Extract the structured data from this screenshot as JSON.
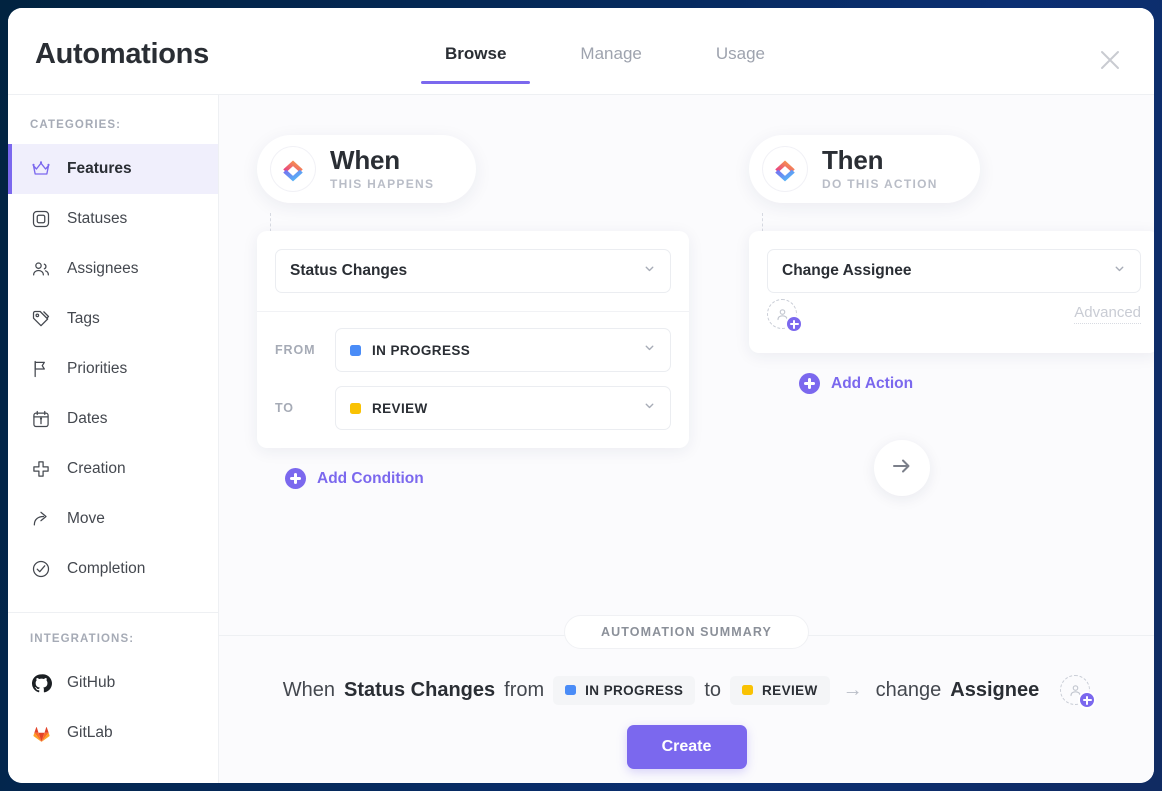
{
  "window": {
    "title": "Automations",
    "close_icon": "close-icon"
  },
  "tabs": [
    {
      "label": "Browse",
      "active": true
    },
    {
      "label": "Manage",
      "active": false
    },
    {
      "label": "Usage",
      "active": false
    }
  ],
  "sidebar": {
    "categories_heading": "CATEGORIES:",
    "integrations_heading": "INTEGRATIONS:",
    "categories": [
      {
        "label": "Features",
        "icon": "crown-icon",
        "active": true
      },
      {
        "label": "Statuses",
        "icon": "square-status-icon",
        "active": false
      },
      {
        "label": "Assignees",
        "icon": "users-icon",
        "active": false
      },
      {
        "label": "Tags",
        "icon": "tag-icon",
        "active": false
      },
      {
        "label": "Priorities",
        "icon": "flag-icon",
        "active": false
      },
      {
        "label": "Dates",
        "icon": "calendar-icon",
        "active": false
      },
      {
        "label": "Creation",
        "icon": "plus-icon",
        "active": false
      },
      {
        "label": "Move",
        "icon": "arrow-forward-icon",
        "active": false
      },
      {
        "label": "Completion",
        "icon": "check-circle-icon",
        "active": false
      }
    ],
    "integrations": [
      {
        "label": "GitHub",
        "icon": "github-icon"
      },
      {
        "label": "GitLab",
        "icon": "gitlab-icon"
      }
    ]
  },
  "builder": {
    "when": {
      "title": "When",
      "subtitle": "THIS HAPPENS",
      "logo_icon": "clickup-logo-icon",
      "trigger_value": "Status Changes",
      "from_label": "FROM",
      "from_value": "IN PROGRESS",
      "from_color": "#4a8cf7",
      "to_label": "TO",
      "to_value": "REVIEW",
      "to_color": "#f9c203",
      "add_condition_label": "Add Condition"
    },
    "then": {
      "title": "Then",
      "subtitle": "DO THIS ACTION",
      "logo_icon": "clickup-logo-icon",
      "action_value": "Change Assignee",
      "advanced_label": "Advanced",
      "add_action_label": "Add Action"
    },
    "flow_arrow_icon": "arrow-right-icon"
  },
  "summary": {
    "pill_label": "AUTOMATION SUMMARY",
    "prefix": "When",
    "trigger": "Status Changes",
    "from_word": "from",
    "from_status": "IN PROGRESS",
    "from_color": "#4a8cf7",
    "to_word": "to",
    "to_status": "REVIEW",
    "to_color": "#f9c203",
    "arrow": "→",
    "action_word": "change",
    "action_target": "Assignee"
  },
  "footer": {
    "create_label": "Create"
  },
  "colors": {
    "accent_purple": "#7b68ee",
    "active_bg": "#f0effc",
    "text_dark": "#2a2e34",
    "text_muted": "#a6abb6",
    "canvas": "#fbfbfd"
  }
}
